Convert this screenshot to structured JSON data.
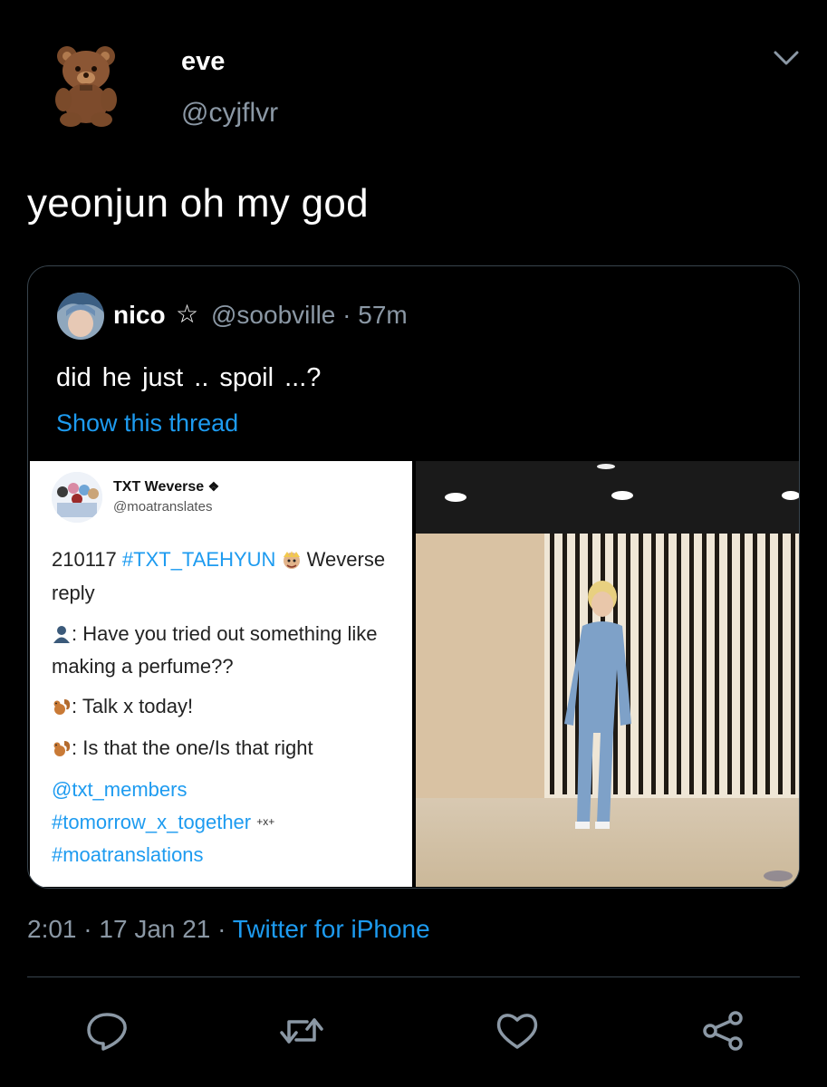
{
  "tweet": {
    "display_name": "eve",
    "handle": "@cyjflvr",
    "text": "yeonjun oh my god",
    "timestamp": "2:01",
    "date": "17 Jan 21",
    "source": "Twitter for iPhone",
    "sep": "·"
  },
  "quote": {
    "display_name": "nico",
    "star": "☆",
    "handle": "@soobville · 57m",
    "text": "did he just .. spoil ...?",
    "show_thread": "Show this thread"
  },
  "media_left": {
    "account_name": "TXT Weverse",
    "account_handle": "@moatranslates",
    "line1_date": "210117",
    "line1_tag": "#TXT_TAEHYUN",
    "line1_rest": "Weverse",
    "line2": "reply",
    "line3": ": Have you tried out something like",
    "line4": "making a perfume??",
    "line5": ": Talk x today!",
    "line6": ": Is that the one/Is that right",
    "link1": "@txt_members",
    "link2": "#tomorrow_x_together",
    "link2_mark": "+x+",
    "link3": "#moatranslations"
  },
  "icons": {
    "reply": "reply-icon",
    "retweet": "retweet-icon",
    "like": "like-icon",
    "share": "share-icon"
  },
  "colors": {
    "background": "#000000",
    "text": "#e7e9ea",
    "secondary": "#8b98a5",
    "accent": "#1d9bf0",
    "border": "#38444d"
  }
}
